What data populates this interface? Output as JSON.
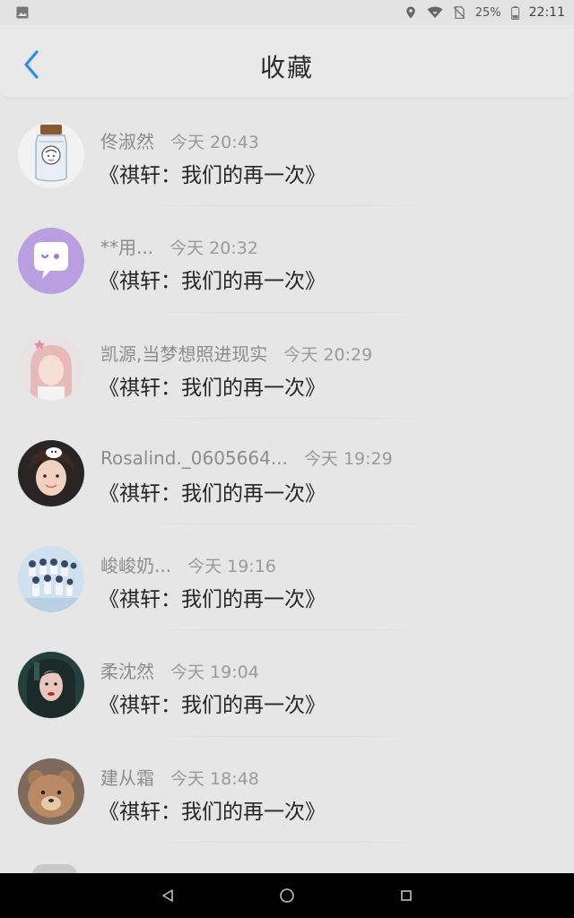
{
  "status_bar": {
    "battery_percent": "25%",
    "time": "22:11"
  },
  "header": {
    "title": "收藏"
  },
  "favorites": [
    {
      "author": "佟淑然",
      "time": "今天 20:43",
      "title": "《祺轩：我们的再一次》"
    },
    {
      "author": "**用...",
      "time": "今天 20:32",
      "title": "《祺轩：我们的再一次》"
    },
    {
      "author": "凯源,当梦想照进现实",
      "time": "今天 20:29",
      "title": "《祺轩：我们的再一次》"
    },
    {
      "author": "Rosalind._0605664...",
      "time": "今天 19:29",
      "title": "《祺轩：我们的再一次》"
    },
    {
      "author": "峻峻奶...",
      "time": "今天 19:16",
      "title": "《祺轩：我们的再一次》"
    },
    {
      "author": "柔沈然",
      "time": "今天 19:04",
      "title": "《祺轩：我们的再一次》"
    },
    {
      "author": "建从霜",
      "time": "今天 18:48",
      "title": "《祺轩：我们的再一次》"
    }
  ],
  "colors": {
    "accent": "#2a8ee6",
    "background": "#e6e6e6",
    "nav_bar": "#000000"
  },
  "icons": {
    "status_left": "image-icon",
    "status_right": [
      "location-icon",
      "wifi-icon",
      "no-sim-icon",
      "battery-icon"
    ],
    "back": "chevron-left-icon",
    "nav": [
      "back-triangle-icon",
      "home-circle-icon",
      "recents-square-icon"
    ]
  }
}
